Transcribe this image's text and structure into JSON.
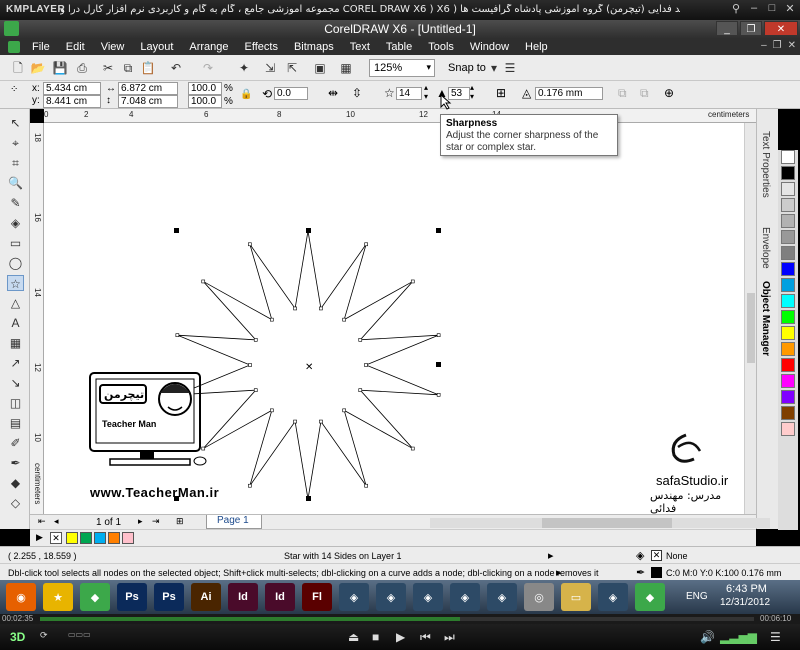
{
  "player": {
    "logo": "KMPLAYER",
    "title": "مجموعه آموزشی جامع ، گام به گام و کاربردی نرم افزار کارل درا و  COREL DRAW X6 ) X6 )  مدرس : سعید فدایی (تیچرمن) گروه آموزشی پادشاه گرافیست ها",
    "time_elapsed": "00:02:35",
    "time_total": "00:06:10"
  },
  "window": {
    "title": "CorelDRAW X6 - [Untitled-1]"
  },
  "menu": [
    "File",
    "Edit",
    "View",
    "Layout",
    "Arrange",
    "Effects",
    "Bitmaps",
    "Text",
    "Table",
    "Tools",
    "Window",
    "Help"
  ],
  "toolbar": {
    "zoom": "125%",
    "snap_to": "Snap to"
  },
  "property_bar": {
    "x": "5.434 cm",
    "y": "8.441 cm",
    "width": "6.872 cm",
    "height": "7.048 cm",
    "scale_x": "100.0",
    "scale_y": "100.0",
    "pct": "%",
    "rotation": "0.0",
    "points": "14",
    "sharpness": "53",
    "outline": "0.176 mm"
  },
  "tooltip": {
    "title": "Sharpness",
    "body": "Adjust the corner sharpness of the star or complex star."
  },
  "ruler": {
    "unit": "centimeters",
    "top_ticks": [
      "0",
      "2",
      "4",
      "6",
      "8",
      "10",
      "12",
      "14"
    ],
    "left_ticks": [
      "18",
      "16",
      "14",
      "12",
      "10"
    ],
    "left_unit": "centimeters"
  },
  "docker_tabs": [
    "Text Properties",
    "Envelope",
    "Object Manager"
  ],
  "palette_colors": [
    "#ffffff",
    "#000000",
    "#e5e5e5",
    "#cccccc",
    "#b2b2b2",
    "#999999",
    "#7f7f7f",
    "#0000ff",
    "#00a0e0",
    "#00ffff",
    "#00ff00",
    "#ffff00",
    "#ff9900",
    "#ff0000",
    "#ff00ff",
    "#8000ff",
    "#7f3f00",
    "#ffcccc"
  ],
  "doc_palette": [
    "#ffff00",
    "#00a651",
    "#00aeef",
    "#ff7f00",
    "#ffc0cb"
  ],
  "pages": {
    "current": "1 of 1",
    "tab": "Page 1"
  },
  "status": {
    "coords": "( 2.255 , 18.559 )",
    "object": "Star with 14 Sides on Layer 1",
    "fill": "None",
    "hint": "Dbl-click tool selects all nodes on the selected object; Shift+click multi-selects; dbl-clicking on a curve adds a node; dbl-clicking on a node removes it",
    "outline": "C:0 M:0 Y:0 K:100  0.176 mm"
  },
  "watermark": {
    "logo_text": "تیچرمن",
    "brand": "Teacher Man",
    "url": "www.TeacherMan.ir",
    "studio": "safaStudio.ir",
    "credit": "مدرس: مهندس فدائی"
  },
  "taskbar": {
    "lang": "ENG",
    "time": "6:43 PM",
    "date": "12/31/2012",
    "apps": [
      "firefox",
      "star",
      "corel-green",
      "Ps",
      "Ps",
      "Ai",
      "Id",
      "Id",
      "Fl",
      "app",
      "app",
      "app",
      "app",
      "app",
      "dvd",
      "folder",
      "app",
      "corel"
    ]
  }
}
